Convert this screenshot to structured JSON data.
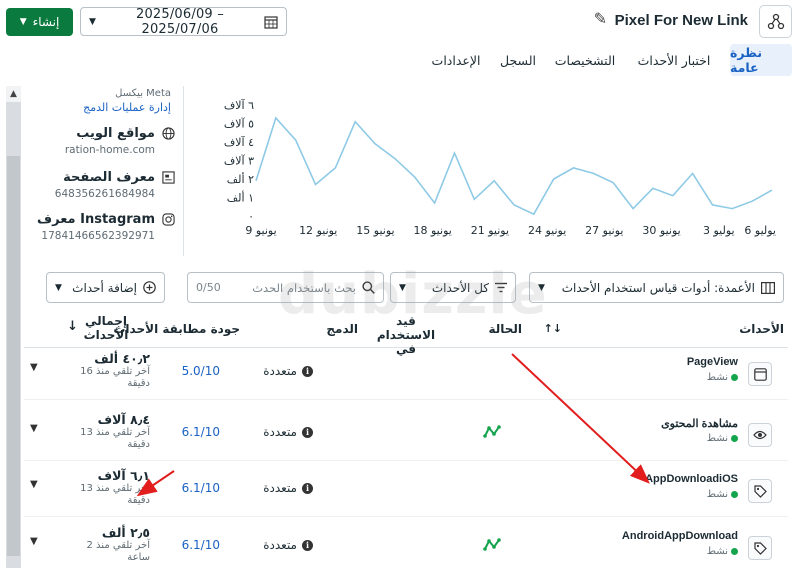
{
  "header": {
    "create_label": "إنشاء",
    "date_range": "2025/06/09 – 2025/07/06",
    "title": "Pixel For New Link"
  },
  "tabs": [
    {
      "label": "نظرة عامة",
      "active": true
    },
    {
      "label": "اختبار الأحداث"
    },
    {
      "label": "التشخيصات"
    },
    {
      "label": "السجل"
    },
    {
      "label": "الإعدادات"
    }
  ],
  "info": {
    "meta_label": "بيكسل Meta",
    "manage_link": "إدارة عمليات الدمج",
    "websites_label": "مواقع الويب",
    "website_value": "ration-home.com",
    "page_id_label": "معرف الصفحة",
    "page_id_value": "648356261684984",
    "instagram_label": "معرف Instagram",
    "instagram_value": "17841466562392971"
  },
  "chart_data": {
    "type": "line",
    "y_ticks": [
      "٦ آلاف",
      "٥ آلاف",
      "٤ آلاف",
      "٣ آلاف",
      "٢ ألف",
      "١ ألف",
      "٠"
    ],
    "ylim": [
      0,
      6000
    ],
    "x_ticks": [
      "6 يوليو",
      "3 يوليو",
      "30 يونيو",
      "27 يونيو",
      "24 يونيو",
      "21 يونيو",
      "18 يونيو",
      "15 يونيو",
      "12 يونيو",
      "9 يونيو"
    ],
    "values": [
      1900,
      5300,
      4100,
      1700,
      2600,
      5100,
      3900,
      3100,
      2100,
      700,
      3400,
      900,
      1900,
      600,
      100,
      2000,
      2600,
      2300,
      1800,
      400,
      1500,
      1100,
      2300,
      600,
      400,
      800,
      1400
    ],
    "color": "#8ecae6"
  },
  "filters": {
    "columns_label": "الأعمدة: أدوات قياس استخدام الأحداث",
    "all_events_label": "كل الأحداث",
    "search_placeholder": "بحث باستخدام الحدث",
    "search_count": "0/50",
    "add_events_label": "إضافة أحداث"
  },
  "table": {
    "headers": {
      "events": "الأحداث",
      "status": "الحالة",
      "usage": "قيد الاستخدام في",
      "integration": "الدمج",
      "emq": "جودة مطابقة الأحداث",
      "total": "إجمالي الأحداث"
    },
    "rows": [
      {
        "name": "PageView",
        "status": "نشط",
        "integration": "متعددة",
        "emq": "5.0/10",
        "total": "٤٠٫٢ ألف",
        "last": "آخر تلقي منذ 16 دقيقة",
        "icon": "browser-icon",
        "diag": false
      },
      {
        "name": "مشاهدة المحتوى",
        "status": "نشط",
        "integration": "متعددة",
        "emq": "6.1/10",
        "total": "٨٫٤ آلاف",
        "last": "آخر تلقي منذ 13 دقيقة",
        "icon": "eye-icon",
        "diag": true
      },
      {
        "name": "AppDownloadiOS",
        "status": "نشط",
        "integration": "متعددة",
        "emq": "6.1/10",
        "total": "٦٫١ آلاف",
        "last": "آخر تلقي منذ 13 دقيقة",
        "icon": "tag-icon",
        "diag": false
      },
      {
        "name": "AndroidAppDownload",
        "status": "نشط",
        "integration": "متعددة",
        "emq": "6.1/10",
        "total": "٢٫٥ ألف",
        "last": "آخر تلقي منذ 2 ساعة",
        "icon": "tag-icon",
        "diag": true
      }
    ]
  },
  "annotations": {
    "arrow_color": "#e11d1d"
  },
  "watermark": "dubizzle"
}
